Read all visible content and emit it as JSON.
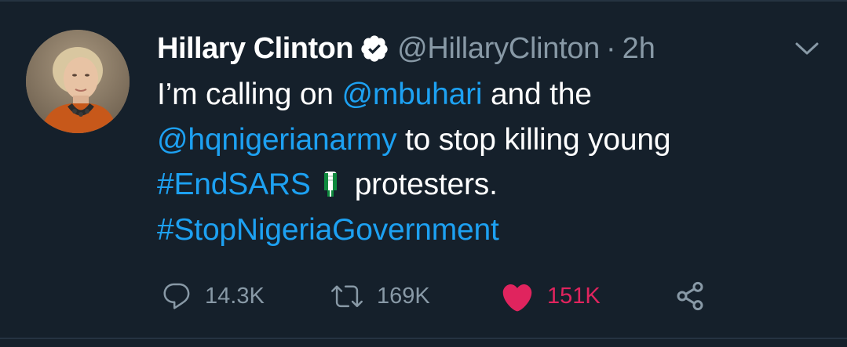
{
  "tweet": {
    "author_name": "Hillary Clinton",
    "handle": "@HillaryClinton",
    "separator": "·",
    "time": "2h",
    "verified": true,
    "body": {
      "line1_prefix": "I’m calling on ",
      "mention1": "@mbuhari",
      "line1_suffix": " and the",
      "mention2": "@hqnigerianarmy",
      "line2_suffix": " to stop killing young",
      "hashtag1": "#EndSARS",
      "emoji_name": "raised-fist-nigeria-flag-emoji",
      "line3_suffix": "protesters.",
      "hashtag2": "#StopNigeriaGovernment"
    },
    "stats": {
      "replies": "14.3K",
      "retweets": "169K",
      "likes": "151K"
    }
  },
  "colors": {
    "background": "#15202b",
    "link": "#1da1f2",
    "muted": "#8899a6",
    "like": "#e0245e",
    "text": "#ffffff"
  },
  "icons": {
    "verified": "verified-badge-icon",
    "caret": "chevron-down-icon",
    "reply": "reply-icon",
    "retweet": "retweet-icon",
    "like": "heart-icon",
    "share": "share-icon"
  }
}
